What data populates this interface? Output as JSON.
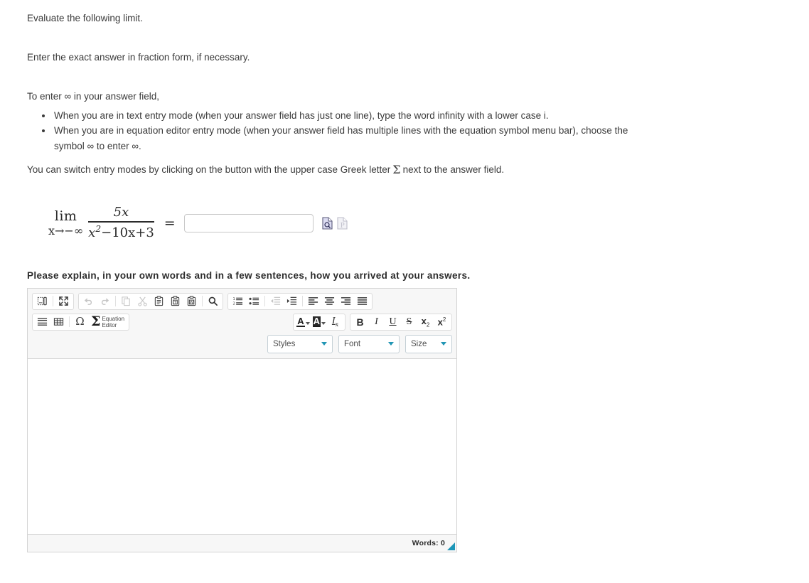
{
  "problem": {
    "instruction_1": "Evaluate the following limit.",
    "instruction_2": "Enter the exact answer in fraction form, if necessary.",
    "infinity_intro": "To enter ∞ in your answer field,",
    "mode_bullets": [
      "When you are in text entry mode (when your answer field has just one line), type the word infinity with a lower case i.",
      "When you are in equation editor entry mode (when your answer field has multiple lines with the equation symbol menu bar), choose the symbol ∞ to enter ∞."
    ],
    "switch_note_before": "You can switch entry modes by clicking on the button with the upper case Greek letter",
    "switch_note_sigma": "Σ",
    "switch_note_after": "next to the answer field."
  },
  "equation": {
    "limit_word": "lim",
    "limit_subscript": "x→−∞",
    "numerator": "5x",
    "denominator_base": "x",
    "denominator_exponent": "2",
    "denominator_rest": "−10x+3",
    "equals": "=",
    "answer_value": "",
    "answer_placeholder": "",
    "preview_icon": "document-magnifier-icon",
    "print_icon": "document-p-icon"
  },
  "explain": {
    "heading": "Please explain, in your own words and in a few sentences, how you arrived at your answers."
  },
  "editor": {
    "toolbar_row1": [
      {
        "name": "templates-button",
        "title": "Templates"
      },
      {
        "name": "maximize-button",
        "title": "Maximize"
      },
      {
        "name": "undo-button",
        "title": "Undo",
        "disabled": true
      },
      {
        "name": "redo-button",
        "title": "Redo",
        "disabled": true
      },
      {
        "name": "copy-button",
        "title": "Copy",
        "disabled": true
      },
      {
        "name": "cut-button",
        "title": "Cut",
        "disabled": true
      },
      {
        "name": "paste-button",
        "title": "Paste"
      },
      {
        "name": "paste-as-text-button",
        "title": "Paste as plain text"
      },
      {
        "name": "paste-from-word-button",
        "title": "Paste from Word"
      },
      {
        "name": "find-button",
        "title": "Find"
      },
      {
        "name": "numbered-list-button",
        "title": "Insert/Remove Numbered List"
      },
      {
        "name": "bulleted-list-button",
        "title": "Insert/Remove Bulleted List"
      },
      {
        "name": "outdent-button",
        "title": "Decrease Indent",
        "disabled": true
      },
      {
        "name": "indent-button",
        "title": "Increase Indent"
      },
      {
        "name": "align-left-button",
        "title": "Align Left"
      },
      {
        "name": "align-center-button",
        "title": "Center"
      },
      {
        "name": "align-right-button",
        "title": "Align Right"
      },
      {
        "name": "justify-button",
        "title": "Justify"
      }
    ],
    "toolbar_row2": [
      {
        "name": "horizontal-rule-button",
        "title": "Insert Horizontal Line"
      },
      {
        "name": "table-button",
        "title": "Table"
      },
      {
        "name": "special-character-button",
        "title": "Insert Special Character",
        "glyph": "Ω"
      },
      {
        "name": "equation-editor-button",
        "title": "Equation Editor"
      },
      {
        "name": "text-color-button",
        "title": "Text Color"
      },
      {
        "name": "background-color-button",
        "title": "Background Color"
      },
      {
        "name": "remove-format-button",
        "title": "Remove Format"
      },
      {
        "name": "bold-button",
        "title": "Bold",
        "glyph": "B"
      },
      {
        "name": "italic-button",
        "title": "Italic",
        "glyph": "I"
      },
      {
        "name": "underline-button",
        "title": "Underline",
        "glyph": "U"
      },
      {
        "name": "strike-button",
        "title": "Strikethrough",
        "glyph": "S"
      },
      {
        "name": "subscript-button",
        "title": "Subscript",
        "glyph": "x"
      },
      {
        "name": "superscript-button",
        "title": "Superscript",
        "glyph": "x"
      }
    ],
    "equation_editor_label_line1": "Equation",
    "equation_editor_label_line2": "Editor",
    "dropdowns": {
      "styles": "Styles",
      "font": "Font",
      "size": "Size"
    },
    "content": "",
    "word_count": "Words: 0",
    "accent_color": "#1d96b8"
  }
}
